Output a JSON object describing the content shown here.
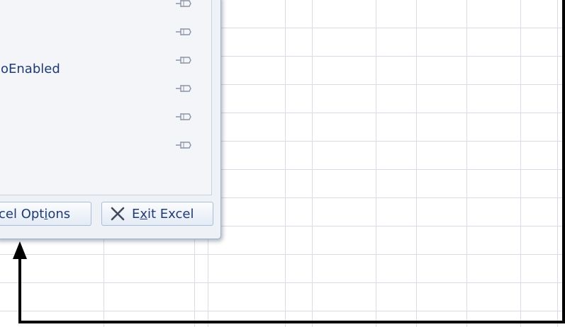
{
  "menu": {
    "recent_documents": [
      {
        "name": "",
        "pinned": false
      },
      {
        "name": "",
        "pinned": false
      },
      {
        "name": "oEnabled",
        "pinned": false
      },
      {
        "name": "",
        "pinned": false
      },
      {
        "name": "",
        "pinned": false
      },
      {
        "name": "",
        "pinned": false
      }
    ],
    "options_label_prefix": "cel Opt",
    "options_label_access": "i",
    "options_label_suffix": "ons",
    "exit_label_prefix": "E",
    "exit_label_access": "x",
    "exit_label_suffix": "it Excel"
  },
  "icons": {
    "pin": "pin-icon",
    "exit": "close-x-icon"
  },
  "colors": {
    "text": "#1f3b73",
    "grid": "#d7dce6",
    "arrow": "#000000"
  }
}
